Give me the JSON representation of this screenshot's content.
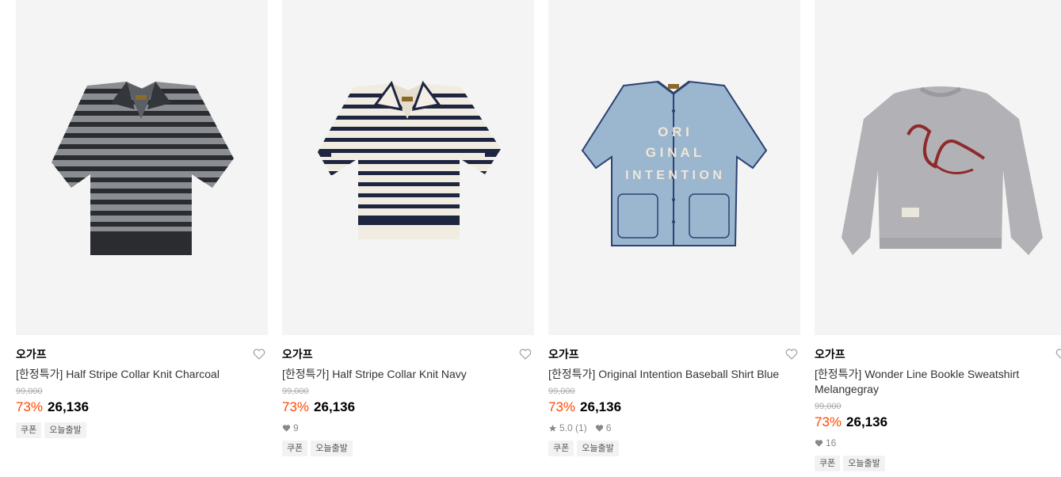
{
  "products": [
    {
      "brand": "오가프",
      "name": "[한정특가] Half Stripe Collar Knit Charcoal",
      "original_price": "99,000",
      "discount": "73%",
      "price": "26,136",
      "tags": [
        "쿠폰",
        "오늘출발"
      ]
    },
    {
      "brand": "오가프",
      "name": "[한정특가] Half Stripe Collar Knit Navy",
      "original_price": "99,000",
      "discount": "73%",
      "price": "26,136",
      "likes": "9",
      "tags": [
        "쿠폰",
        "오늘출발"
      ]
    },
    {
      "brand": "오가프",
      "name": "[한정특가] Original Intention Baseball Shirt Blue",
      "original_price": "99,000",
      "discount": "73%",
      "price": "26,136",
      "rating": "5.0 (1)",
      "likes": "6",
      "print_text": [
        "O R I",
        "G I N A L",
        "I N T E N T I O N"
      ],
      "tags": [
        "쿠폰",
        "오늘출발"
      ]
    },
    {
      "brand": "오가프",
      "name": "[한정특가] Wonder Line Bookle Sweatshirt Melangegray",
      "original_price": "99,000",
      "discount": "73%",
      "price": "26,136",
      "likes": "16",
      "tags": [
        "쿠폰",
        "오늘출발"
      ]
    }
  ],
  "icons": {
    "like": "heart-outline-icon",
    "like_count": "heart-filled-icon",
    "rating": "star-icon"
  },
  "colors": {
    "discount": "#ff4800",
    "thumb_bg": "#f4f4f4"
  }
}
